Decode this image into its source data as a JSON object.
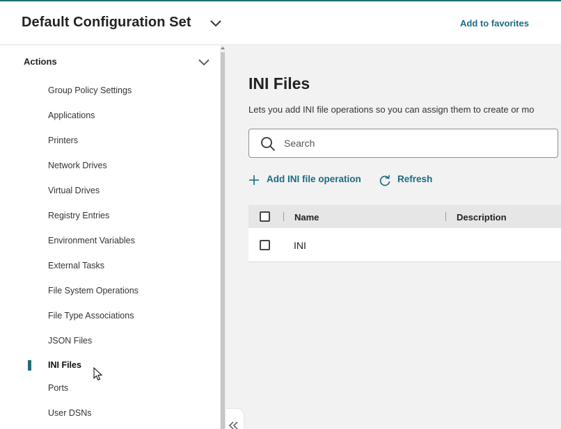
{
  "header": {
    "title": "Default Configuration Set",
    "favorites_label": "Add to favorites"
  },
  "sidebar": {
    "section_label": "Actions",
    "items": [
      {
        "label": "Group Policy Settings"
      },
      {
        "label": "Applications"
      },
      {
        "label": "Printers"
      },
      {
        "label": "Network Drives"
      },
      {
        "label": "Virtual Drives"
      },
      {
        "label": "Registry Entries"
      },
      {
        "label": "Environment Variables"
      },
      {
        "label": "External Tasks"
      },
      {
        "label": "File System Operations"
      },
      {
        "label": "File Type Associations"
      },
      {
        "label": "JSON Files"
      },
      {
        "label": "INI Files",
        "active": true
      },
      {
        "label": "Ports"
      },
      {
        "label": "User DSNs"
      }
    ]
  },
  "main": {
    "title": "INI Files",
    "description": "Lets you add INI file operations so you can assign them to create or mo",
    "search": {
      "placeholder": "Search",
      "value": ""
    },
    "add_label": "Add INI file operation",
    "refresh_label": "Refresh",
    "table": {
      "columns": [
        "Name",
        "Description"
      ],
      "rows": [
        {
          "name": "INI",
          "description": ""
        }
      ]
    }
  },
  "colors": {
    "accent": "#1e6e72",
    "link": "#1a6b84",
    "background": "#f2f2f2"
  },
  "icons": {
    "title_toggle": "chevron-down-icon",
    "actions_toggle": "chevron-down-icon",
    "search": "search-icon",
    "add": "plus-icon",
    "refresh": "refresh-icon",
    "collapse": "double-chevron-left-icon"
  }
}
